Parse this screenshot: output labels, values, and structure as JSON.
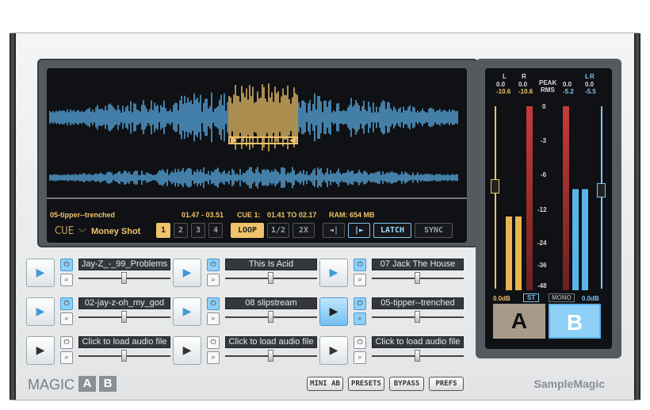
{
  "wave": {
    "track": "05-tipper--trenched",
    "time": "01.47 - 03.51",
    "cue": "CUE 1:",
    "cue_range": "01.41 TO 02.17",
    "ram": "RAM: 654 MB"
  },
  "controls": {
    "cue_label": "CUE",
    "cue_name": "Money Shot",
    "cues": [
      "1",
      "2",
      "3",
      "4"
    ],
    "loop": "LOOP",
    "half": "1/2",
    "double": "2X",
    "back": "◄|",
    "fwd": "|►",
    "latch": "LATCH",
    "sync": "SYNC"
  },
  "meters": {
    "l": "L",
    "r": "R",
    "l2": "L",
    "r2": "R",
    "peak": "PEAK",
    "rms": "RMS",
    "vals": [
      "0.0",
      "0.0",
      "-10.6",
      "-10.6",
      "0.0",
      "0.0",
      "-5.2",
      "-5.5"
    ],
    "scale": [
      "0",
      "-3",
      "-6",
      "-12",
      "-24",
      "-36",
      "-48"
    ],
    "gain_left": "0.0dB",
    "gain_right": "0.0dB",
    "st": "ST",
    "mono": "MONO",
    "a": "A",
    "b": "B"
  },
  "slots": [
    "Jay-Z_-_99_Problems",
    "This Is Acid",
    "07 Jack The House",
    "02-jay-z-oh_my_god",
    "08 slipstream",
    "05-tipper--trenched",
    "Click to load audio file",
    "Click to load audio file",
    "Click to load audio file"
  ],
  "bottom": {
    "logo": "MAGIC",
    "a": "A",
    "b": "B",
    "mini": "MINI AB",
    "presets": "PRESETS",
    "bypass": "BYPASS",
    "prefs": "PREFS",
    "brand": "SampleMagic"
  }
}
